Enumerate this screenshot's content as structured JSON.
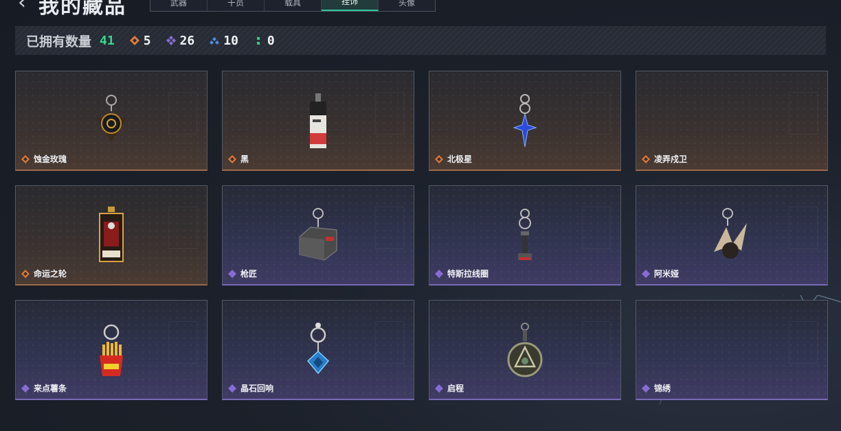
{
  "header": {
    "back_icon": "chevron-left-icon",
    "title": "我的藏品",
    "tabs": [
      {
        "label": "武器",
        "active": false
      },
      {
        "label": "干员",
        "active": false
      },
      {
        "label": "载具",
        "active": false
      },
      {
        "label": "挂饰",
        "active": true
      },
      {
        "label": "头像",
        "active": false
      }
    ]
  },
  "stats": {
    "owned_label": "已拥有数量",
    "owned_count": "41",
    "counts": [
      {
        "icon": "orange-diamond-icon",
        "color": "#e07a3c",
        "value": "5"
      },
      {
        "icon": "purple-diamond-icon",
        "color": "#8b6dd8",
        "value": "26"
      },
      {
        "icon": "blue-diamond-icon",
        "color": "#4a8ee0",
        "value": "10"
      },
      {
        "icon": "green-dots-icon",
        "color": "#35c98a",
        "value": "0"
      }
    ]
  },
  "colors": {
    "accent": "#2ec59a",
    "gold": "#e07a3c",
    "purple": "#8b6dd8"
  },
  "items": [
    {
      "name": "蚀金玫瑰",
      "rarity": "gold",
      "icon": "rose-charm-icon"
    },
    {
      "name": "黑",
      "rarity": "gold",
      "icon": "tag-charm-icon"
    },
    {
      "name": "北极星",
      "rarity": "gold",
      "icon": "star-charm-icon"
    },
    {
      "name": "凌弄戍卫",
      "rarity": "gold",
      "icon": "empty-charm-icon"
    },
    {
      "name": "命运之轮",
      "rarity": "gold",
      "icon": "card-charm-icon"
    },
    {
      "name": "枪匠",
      "rarity": "purple",
      "icon": "box-charm-icon"
    },
    {
      "name": "特斯拉线圈",
      "rarity": "purple",
      "icon": "coil-charm-icon"
    },
    {
      "name": "阿米娅",
      "rarity": "purple",
      "icon": "ears-charm-icon"
    },
    {
      "name": "来点薯条",
      "rarity": "purple",
      "icon": "fries-charm-icon"
    },
    {
      "name": "晶石回响",
      "rarity": "purple",
      "icon": "crystal-charm-icon"
    },
    {
      "name": "启程",
      "rarity": "purple",
      "icon": "medal-charm-icon"
    },
    {
      "name": "锦绣",
      "rarity": "purple",
      "icon": "empty-charm-icon"
    }
  ]
}
